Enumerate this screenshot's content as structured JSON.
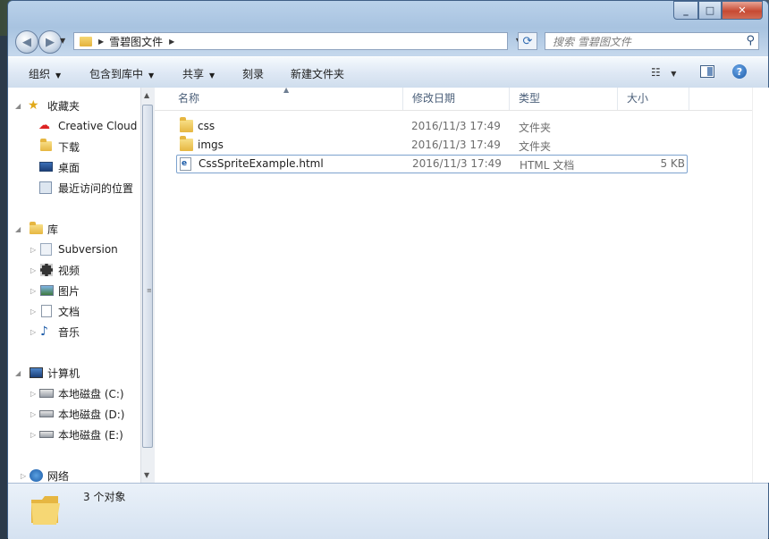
{
  "window": {
    "caption_min": "_",
    "caption_max": "□",
    "caption_close": "✕"
  },
  "address": {
    "current_folder": "雪碧图文件",
    "search_placeholder": "搜索 雪碧图文件"
  },
  "toolbar": {
    "organize": "组织",
    "include_in_library": "包含到库中",
    "share": "共享",
    "burn": "刻录",
    "new_folder": "新建文件夹"
  },
  "nav_pane": {
    "favorites": "收藏夹",
    "favorites_items": [
      "Creative Cloud",
      "下载",
      "桌面",
      "最近访问的位置"
    ],
    "libraries": "库",
    "libraries_items": [
      "Subversion",
      "视频",
      "图片",
      "文档",
      "音乐"
    ],
    "computer": "计算机",
    "computer_items": [
      "本地磁盘 (C:)",
      "本地磁盘 (D:)",
      "本地磁盘 (E:)"
    ],
    "network": "网络"
  },
  "columns": {
    "name": "名称",
    "modified": "修改日期",
    "type": "类型",
    "size": "大小"
  },
  "files": [
    {
      "name": "css",
      "modified": "2016/11/3 17:49",
      "type": "文件夹",
      "size": ""
    },
    {
      "name": "imgs",
      "modified": "2016/11/3 17:49",
      "type": "文件夹",
      "size": ""
    },
    {
      "name": "CssSpriteExample.html",
      "modified": "2016/11/3 17:49",
      "type": "HTML 文档",
      "size": "5 KB"
    }
  ],
  "status": {
    "item_count": "3 个对象"
  },
  "colors": {
    "folder": "#e6b641",
    "accent": "#2f6ab0",
    "close": "#c74a33"
  }
}
